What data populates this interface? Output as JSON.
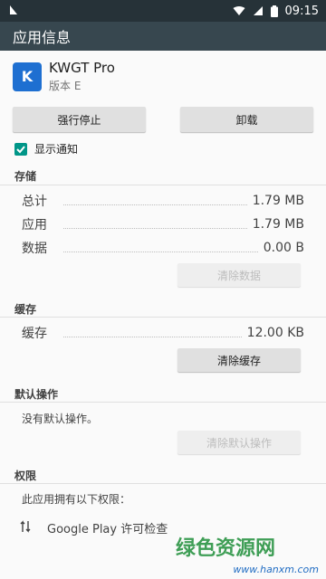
{
  "status_bar": {
    "time": "09:15"
  },
  "app_bar": {
    "title": "应用信息"
  },
  "app": {
    "name": "KWGT Pro",
    "version": "版本 E",
    "icon_letter": "K"
  },
  "buttons": {
    "force_stop": "强行停止",
    "uninstall": "卸载"
  },
  "notifications": {
    "label": "显示通知",
    "checked": true
  },
  "storage": {
    "title": "存储",
    "rows": [
      {
        "label": "总计",
        "value": "1.79 MB"
      },
      {
        "label": "应用",
        "value": "1.79 MB"
      },
      {
        "label": "数据",
        "value": "0.00 B"
      }
    ],
    "clear_data": "清除数据"
  },
  "cache": {
    "title": "缓存",
    "row": {
      "label": "缓存",
      "value": "12.00 KB"
    },
    "clear_cache": "清除缓存"
  },
  "defaults": {
    "title": "默认操作",
    "text": "没有默认操作。",
    "clear_defaults": "清除默认操作"
  },
  "permissions": {
    "title": "权限",
    "text": "此应用拥有以下权限：",
    "items": [
      {
        "icon": "sync-arrows-icon",
        "label": "Google Play 许可检查"
      }
    ]
  },
  "watermark": {
    "top": "绿色资源网",
    "bottom": "www.hanxm.com"
  }
}
